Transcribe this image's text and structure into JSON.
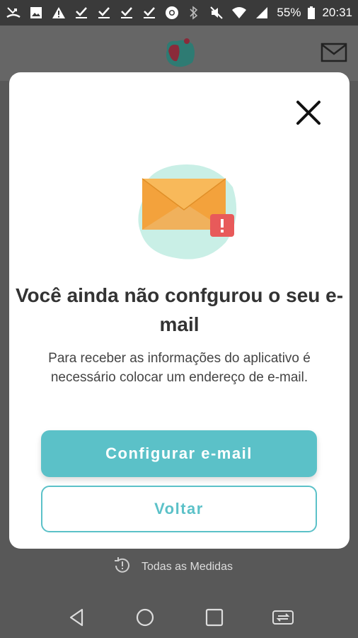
{
  "status_bar": {
    "battery": "55%",
    "time": "20:31",
    "left_icons": [
      "missed-call-icon",
      "image-icon",
      "warning-icon",
      "download-done-icon",
      "download-done-icon",
      "download-done-icon",
      "download-done-icon",
      "chrome-icon"
    ],
    "right_icons": [
      "bluetooth-icon",
      "mute-icon",
      "wifi-icon",
      "signal-icon",
      "battery-icon"
    ]
  },
  "modal": {
    "title": "Você ainda não confgurou o seu e-mail",
    "body": "Para receber as informações do aplicativo é necessário colocar um endereço de e-mail.",
    "primary_button": "Configurar e-mail",
    "secondary_button": "Voltar"
  },
  "background": {
    "bottom_link": "Todas as Medidas"
  },
  "colors": {
    "accent": "#5bc1c8",
    "envelope": "#f3a23c",
    "blob": "#c9efe6",
    "alert": "#e85a5a"
  }
}
